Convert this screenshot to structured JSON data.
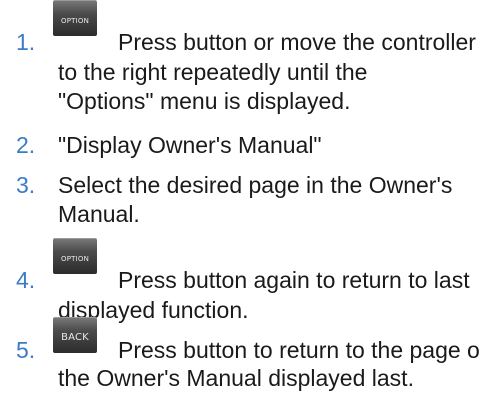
{
  "colors": {
    "accent": "#3a7cc7",
    "text": "#1a1a1a"
  },
  "steps": [
    {
      "number": "1.",
      "key_label": "OPTION",
      "line1": "Press button or move the controller",
      "rest": "to the right repeatedly until the \"Options\" menu is displayed."
    },
    {
      "number": "2.",
      "text": "\"Display Owner's Manual\""
    },
    {
      "number": "3.",
      "text": "Select the desired page in the Owner's Manual."
    },
    {
      "number": "4.",
      "key_label": "OPTION",
      "line1": "Press button again to return to last",
      "rest": "displayed function."
    },
    {
      "number": "5.",
      "key_label": "BACK",
      "line1": "Press button to return to the page of",
      "rest": "the Owner's Manual displayed last."
    }
  ]
}
